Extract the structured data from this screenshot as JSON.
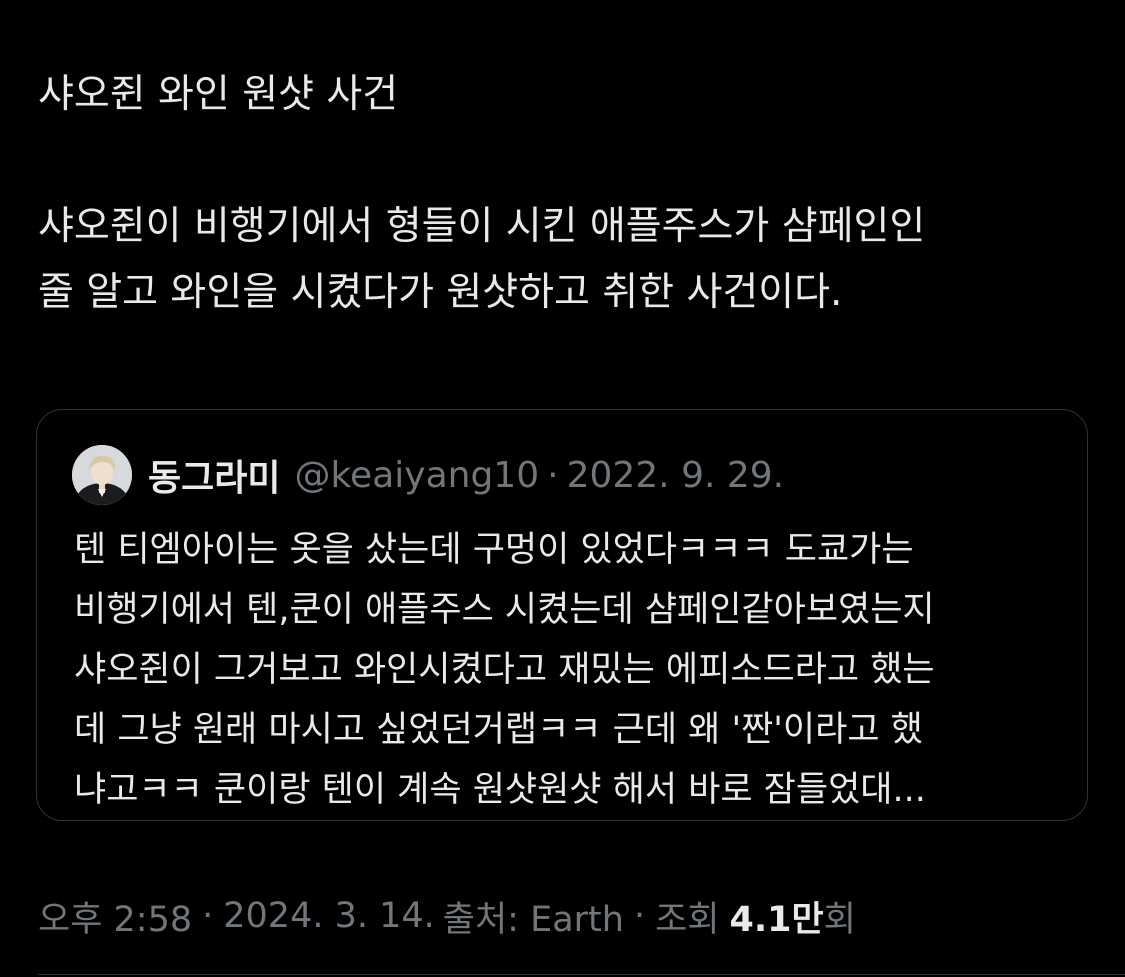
{
  "tweet": {
    "title_line": "샤오쥔 와인 원샷 사건",
    "body": "샤오쥔이 비행기에서 형들이 시킨 애플주스가 샴페인인\n줄 알고 와인을 시켰다가 원샷하고 취한 사건이다."
  },
  "quote": {
    "display_name": "동그라미",
    "handle": "@keaiyang10",
    "separator": "·",
    "date": "2022. 9. 29.",
    "avatar_icon": "user-avatar-photo",
    "text": "텐 티엠아이는 옷을 샀는데 구멍이 있었다ㅋㅋㅋ 도쿄가는\n비행기에서 텐,쿤이 애플주스 시켰는데 샴페인같아보였는지\n샤오쥔이 그거보고 와인시켰다고 재밌는 에피소드라고 했는\n데 그냥 원래 마시고 싶었던거랩ㅋㅋ 근데 왜 '짠'이라고 했\n냐고ㅋㅋ 쿤이랑 텐이 계속 원샷원샷 해서 바로 잠들었대..."
  },
  "meta": {
    "time": "오후 2:58",
    "separator": "·",
    "date": "2024. 3. 14.",
    "source": "출처: Earth",
    "views_label": "조회",
    "views_count": "4.1만",
    "views_suffix": "회"
  },
  "colors": {
    "background": "#000000",
    "text_primary": "#e7e9ea",
    "text_secondary": "#71767b",
    "border": "#2f3336"
  }
}
